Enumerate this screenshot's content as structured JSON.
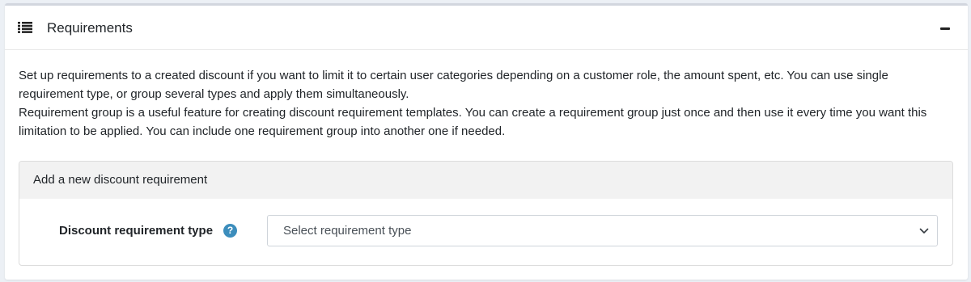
{
  "panel": {
    "title": "Requirements",
    "header_icon": "list-icon",
    "collapse_icon": "minus-icon"
  },
  "description": {
    "paragraph1": "Set up requirements to a created discount if you want to limit it to certain user categories depending on a customer role, the amount spent, etc. You can use single requirement type, or group several types and apply them simultaneously.",
    "paragraph2": "Requirement group is a useful feature for creating discount requirement templates. You can create a requirement group just once and then use it every time you want this limitation to be applied. You can include one requirement group into another one if needed."
  },
  "add_requirement": {
    "title": "Add a new discount requirement",
    "field_label": "Discount requirement type",
    "help_icon": "question-circle-icon",
    "help_glyph": "?",
    "select_value": "Select requirement type",
    "select_icon": "chevron-down-icon"
  },
  "colors": {
    "accent": "#3c8dbc",
    "header_bg": "#f2f2f2",
    "page_bg": "#ecf0f5"
  }
}
